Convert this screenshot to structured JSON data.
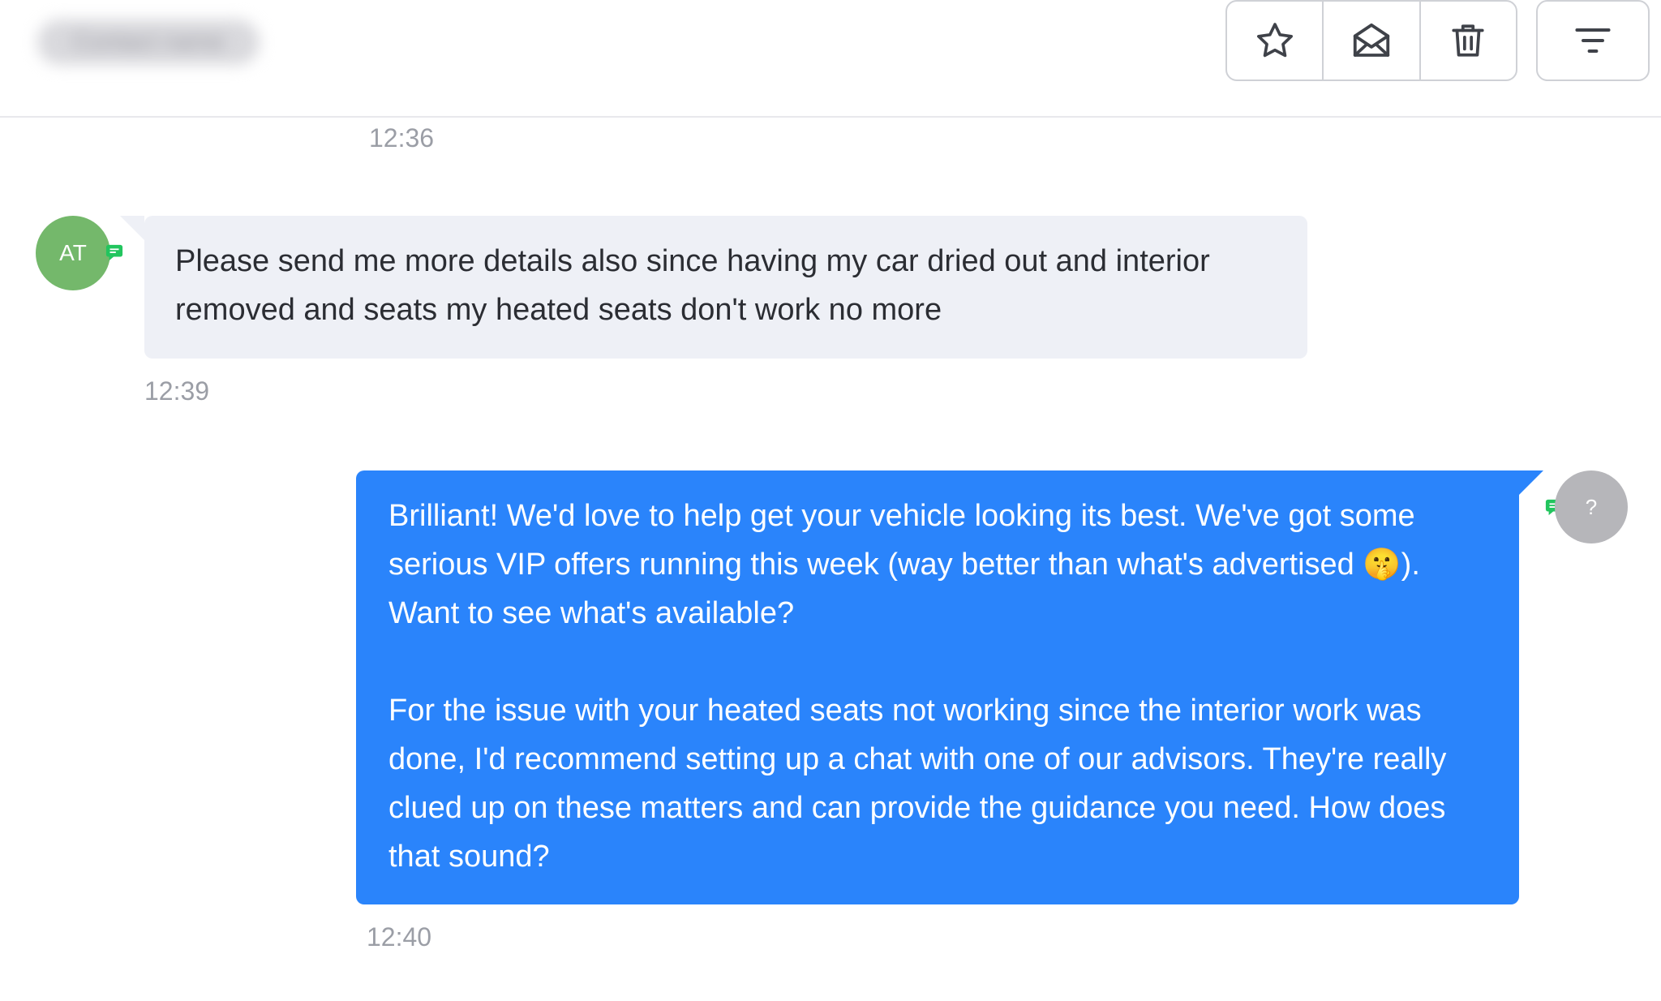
{
  "header": {
    "contact_name": "Contact name",
    "toolbar": {
      "star_icon": "star-icon",
      "mail_icon": "open-envelope-icon",
      "delete_icon": "trash-icon",
      "filter_icon": "filter-lines-icon"
    }
  },
  "colors": {
    "outgoing_bubble": "#2a84fb",
    "incoming_bubble": "#eef0f6",
    "contact_avatar": "#74b86b",
    "agent_avatar": "#b6b6ba",
    "channel_badge": "#22c55e"
  },
  "conversation": {
    "previous_timestamp": "12:36",
    "messages": [
      {
        "direction": "incoming",
        "avatar_initials": "AT",
        "channel_icon": "sms-chat-icon",
        "text": "Please send me more details also since having my car dried out and interior removed and seats my heated seats don't work no more",
        "timestamp": "12:39"
      },
      {
        "direction": "outgoing",
        "avatar_initials": "?",
        "channel_icon": "sms-chat-icon",
        "paragraphs": [
          "Brilliant! We'd love to help get your vehicle looking its best. We've got some serious VIP offers running this week (way better than what's advertised 🤫). Want to see what's available?",
          "For the issue with your heated seats not working since the interior work was done, I'd recommend setting up a chat with one of our advisors. They're really clued up on these matters and can provide the guidance you need. How does that sound?"
        ],
        "timestamp": "12:40"
      }
    ]
  }
}
